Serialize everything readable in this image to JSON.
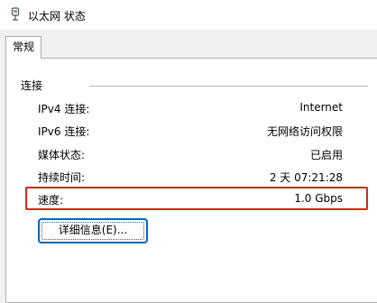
{
  "window": {
    "title": "以太网 状态",
    "icon": "network-adapter-icon"
  },
  "tabs": [
    {
      "label": "常规"
    }
  ],
  "connection": {
    "group_label": "连接",
    "rows": [
      {
        "label": "IPv4 连接:",
        "value": "Internet"
      },
      {
        "label": "IPv6 连接:",
        "value": "无网络访问权限"
      },
      {
        "label": "媒体状态:",
        "value": "已启用"
      },
      {
        "label": "持续时间:",
        "value": "2 天 07:21:28"
      },
      {
        "label": "速度:",
        "value": "1.0 Gbps"
      }
    ]
  },
  "details_button": {
    "label": "详细信息(E)..."
  },
  "colors": {
    "highlight": "#e0231b",
    "focus": "#0067c0"
  }
}
